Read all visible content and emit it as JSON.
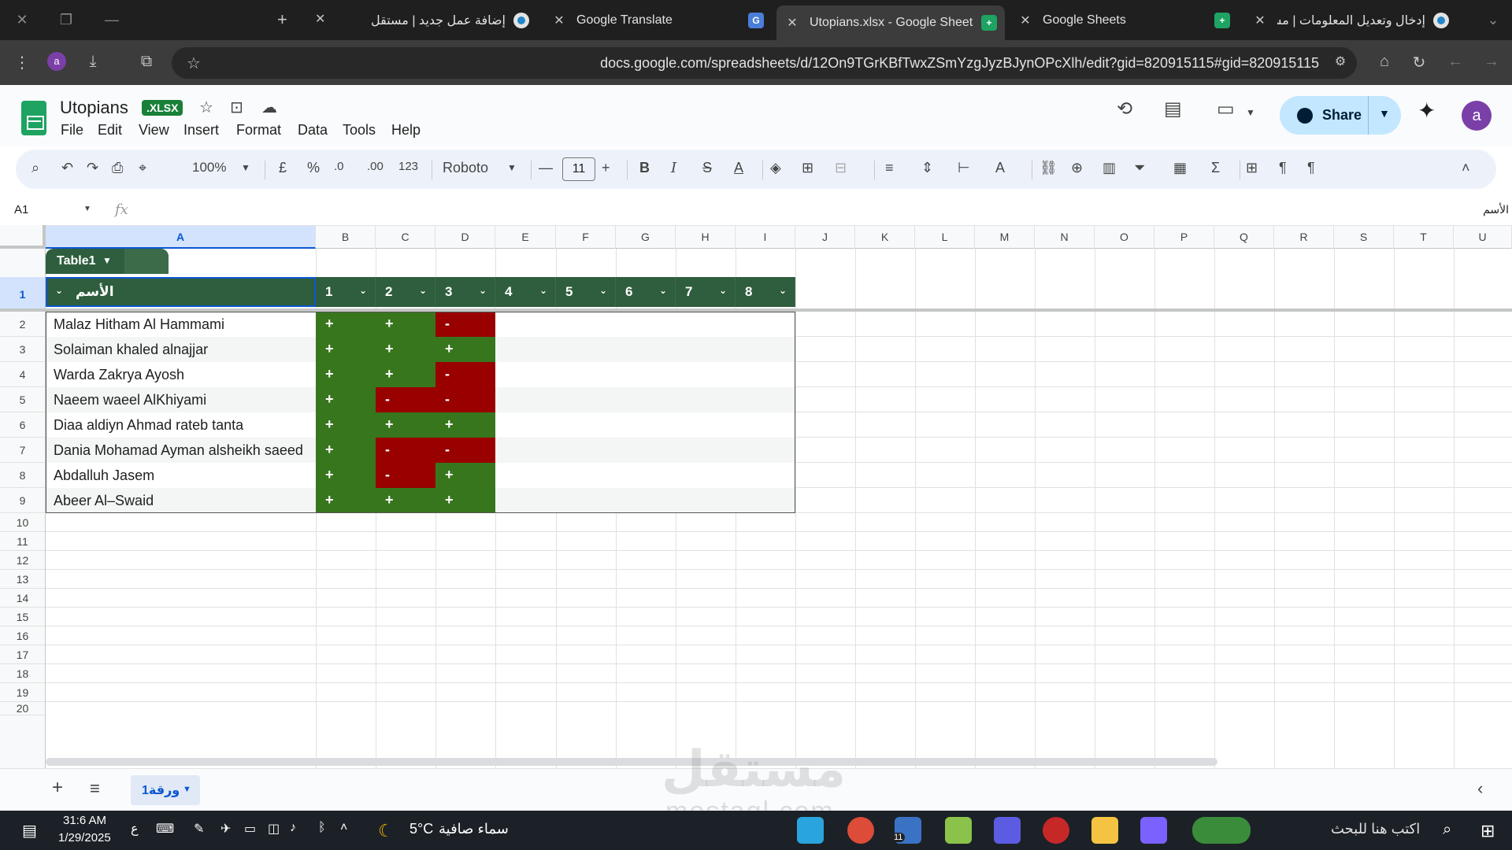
{
  "browser": {
    "tabs": [
      {
        "title": "إدخال وتعديل المعلومات | مستقل",
        "icon": "mostaql-icon",
        "active": false
      },
      {
        "title": "Google Sheets",
        "icon": "sheets-icon",
        "active": false
      },
      {
        "title": "Utopians.xlsx - Google Sheets",
        "icon": "sheets-icon",
        "active": true
      },
      {
        "title": "Google Translate",
        "icon": "translate-icon",
        "active": false
      },
      {
        "title": "إضافة عمل جديد | مستقل",
        "icon": "mostaql-icon",
        "active": false
      }
    ],
    "url": "docs.google.com/spreadsheets/d/12On9TGrKBfTwxZSmYzgJyzBJynOPcXlh/edit?gid=820915115#gid=820915115",
    "profile_initial": "a"
  },
  "doc": {
    "title": "Utopians",
    "badge": ".XLSX",
    "menu": [
      "File",
      "Edit",
      "View",
      "Insert",
      "Format",
      "Data",
      "Tools",
      "Help"
    ],
    "share_label": "Share",
    "user_initial": "a"
  },
  "toolbar": {
    "zoom": "100%",
    "currency": "£",
    "percent": "%",
    "decimal_down": ".0",
    "decimal_up": ".00",
    "number_format": "123",
    "font": "Roboto",
    "font_size": "11",
    "bold": "B",
    "italic": "I",
    "strike": "S",
    "text_color": "A",
    "sum": "Σ"
  },
  "formula_bar": {
    "cell_ref": "A1",
    "fx": "fx",
    "value": "الأسم"
  },
  "grid": {
    "columns": [
      "A",
      "B",
      "C",
      "D",
      "E",
      "F",
      "G",
      "H",
      "I",
      "J",
      "K",
      "L",
      "M",
      "N",
      "O",
      "P",
      "Q",
      "R",
      "S",
      "T",
      "U"
    ],
    "rows": [
      "1",
      "2",
      "3",
      "4",
      "5",
      "6",
      "7",
      "8",
      "9",
      "10",
      "11",
      "12",
      "13",
      "14",
      "15",
      "16",
      "17",
      "18",
      "19",
      "20"
    ],
    "table_name": "Table1",
    "headers": [
      "الأسم",
      "1",
      "2",
      "3",
      "4",
      "5",
      "6",
      "7",
      "8"
    ],
    "records": [
      {
        "name": "Malaz Hitham Al Hammami",
        "marks": [
          "+",
          "+",
          "-"
        ]
      },
      {
        "name": "Solaiman khaled alnajjar",
        "marks": [
          "+",
          "+",
          "+"
        ]
      },
      {
        "name": "Warda Zakrya Ayosh",
        "marks": [
          "+",
          "+",
          "-"
        ]
      },
      {
        "name": "Naeem waeel AlKhiyami",
        "marks": [
          "+",
          "-",
          "-"
        ]
      },
      {
        "name": "Diaa aldiyn Ahmad rateb tanta",
        "marks": [
          "+",
          "+",
          "+"
        ]
      },
      {
        "name": "Dania Mohamad Ayman alsheikh saeed",
        "marks": [
          "+",
          "-",
          "-"
        ]
      },
      {
        "name": "Abdalluh Jasem",
        "marks": [
          "+",
          "-",
          "+"
        ]
      },
      {
        "name": "Abeer Al–Swaid",
        "marks": [
          "+",
          "+",
          "+"
        ]
      }
    ],
    "colors": {
      "plus": "#38761d",
      "minus": "#990000",
      "header": "#2e5e3d"
    }
  },
  "sheets": {
    "active_sheet": "ورقة1"
  },
  "watermark": {
    "arabic": "مستقل",
    "latin": "mostaql.com"
  },
  "taskbar": {
    "time": "31:6 AM",
    "date": "1/29/2025",
    "lang": "ع",
    "temperature": "5°C",
    "weather": "سماء صافية",
    "search_placeholder": "اكتب هنا للبحث",
    "badge_count": "11"
  }
}
